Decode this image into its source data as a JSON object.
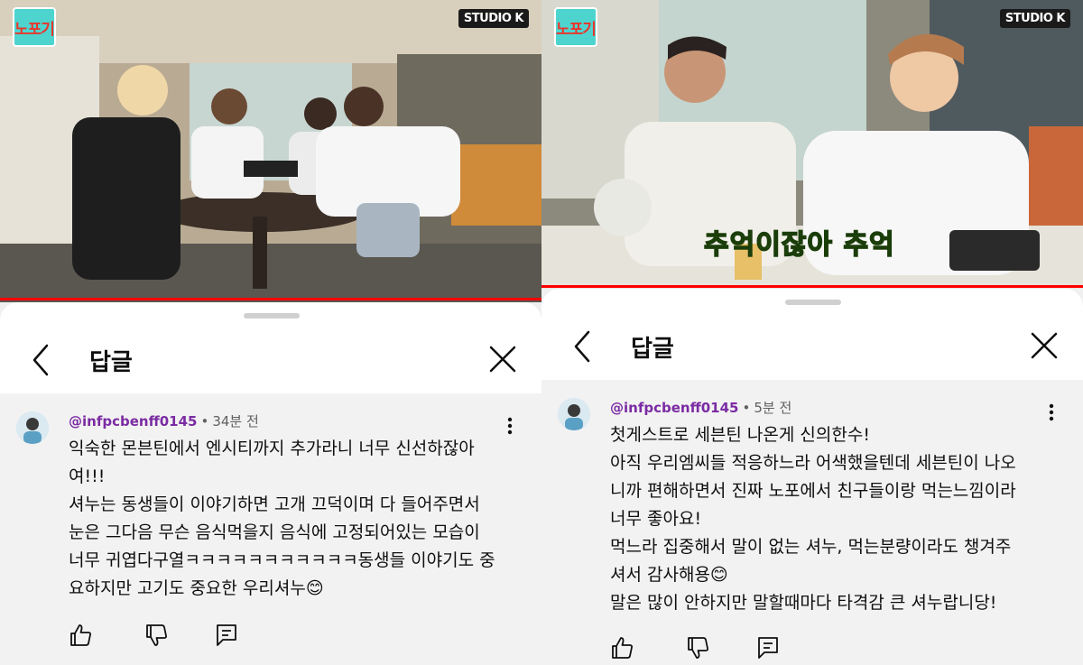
{
  "left": {
    "channel_logo": "노포기",
    "studio_logo": "STUDIO K",
    "sheet": {
      "title": "답글",
      "back_icon": "chevron-left-icon",
      "close_icon": "close-icon"
    },
    "comment": {
      "author": "@infpcbenff0145",
      "time": "34분 전",
      "lines": [
        "익숙한 몬븐틴에서 엔시티까지 추가라니 너무 신선하잖아",
        "여!!!",
        "셔누는 동생들이 이야기하면 고개 끄덕이며 다 들어주면서",
        "눈은 그다음 무슨 음식먹을지 음식에 고정되어있는 모습이",
        "너무 귀엽다구열ㅋㅋㅋㅋㅋㅋㅋㅋㅋㅋㅋ동생들 이야기도 중",
        "요하지만 고기도 중요한 우리셔누😊"
      ]
    }
  },
  "right": {
    "channel_logo": "노포기",
    "studio_logo": "STUDIO K",
    "subtitle": "추억이잖아 추억",
    "sheet": {
      "title": "답글",
      "back_icon": "chevron-left-icon",
      "close_icon": "close-icon"
    },
    "comment": {
      "author": "@infpcbenff0145",
      "time": "5분 전",
      "lines": [
        "첫게스트로 세븐틴 나온게 신의한수!",
        "아직 우리엠씨들 적응하느라 어색했을텐데 세븐틴이 나오",
        "니까 편해하면서 진짜 노포에서 친구들이랑 먹는느낌이라",
        "너무 좋아요!",
        "먹느라 집중해서 말이 없는 셔누, 먹는분량이라도 챙겨주",
        "셔서 감사해용😊",
        "말은 많이 안하지만 말할때마다 타격감 큰 셔누랍니당!"
      ]
    }
  },
  "colors": {
    "progress": "#ff0000",
    "handle": "#7b2ba3",
    "subtitle": "#9be33f"
  }
}
